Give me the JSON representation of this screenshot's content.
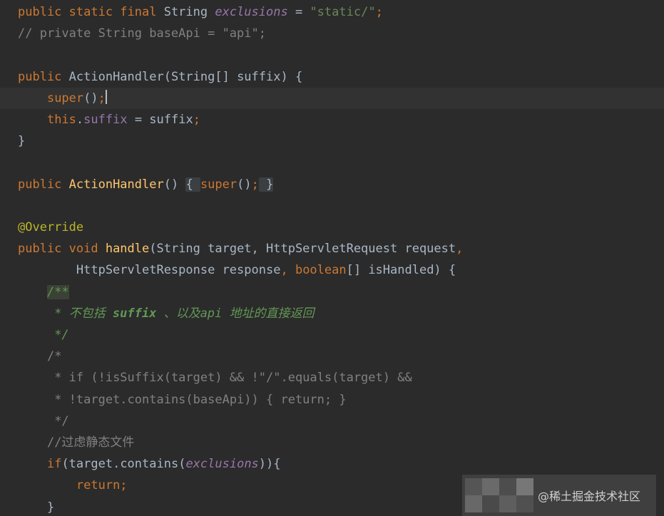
{
  "editor": {
    "lines": [
      [
        [
          "kw",
          "public static final "
        ],
        [
          "t",
          "String "
        ],
        [
          "fld",
          "exclusions"
        ],
        [
          "t",
          " = "
        ],
        [
          "str",
          "\"static/\""
        ],
        [
          "kw",
          ";"
        ]
      ],
      [
        [
          "cmt",
          "// private String baseApi = \"api\";"
        ]
      ],
      [],
      [
        [
          "kw",
          "public "
        ],
        [
          "ctor",
          "ActionHandler"
        ],
        [
          "t",
          "(String[] suffix) {"
        ]
      ],
      [
        [
          "t",
          "    "
        ],
        [
          "kw",
          "super"
        ],
        [
          "t",
          "()"
        ],
        [
          "kw",
          ";"
        ],
        [
          "caret",
          ""
        ]
      ],
      [
        [
          "t",
          "    "
        ],
        [
          "kw",
          "this"
        ],
        [
          "t",
          "."
        ],
        [
          "fldp",
          "suffix"
        ],
        [
          "t",
          " = suffix"
        ],
        [
          "kw",
          ";"
        ]
      ],
      [
        [
          "t",
          "}"
        ]
      ],
      [],
      [
        [
          "kw",
          "public "
        ],
        [
          "fn",
          "ActionHandler"
        ],
        [
          "t",
          "()"
        ],
        [
          "t",
          " "
        ],
        [
          "fold",
          "{ "
        ],
        [
          "kw",
          "super"
        ],
        [
          "t",
          "()"
        ],
        [
          "kw",
          ";"
        ],
        [
          "fold",
          " }"
        ]
      ],
      [],
      [
        [
          "ann",
          "@Override"
        ]
      ],
      [
        [
          "kw",
          "public void "
        ],
        [
          "fn",
          "handle"
        ],
        [
          "t",
          "(String target, HttpServletRequest request"
        ],
        [
          "kw",
          ","
        ]
      ],
      [
        [
          "t",
          "        HttpServletResponse response"
        ],
        [
          "kw",
          ", "
        ],
        [
          "kw",
          "boolean"
        ],
        [
          "t",
          "[] isHandled) {"
        ]
      ],
      [
        [
          "t",
          "    "
        ],
        [
          "hldoc",
          "/**"
        ]
      ],
      [
        [
          "t",
          "     "
        ],
        [
          "doc",
          "* 不包括 "
        ],
        [
          "docb",
          "suffix"
        ],
        [
          "doc",
          " 、以及api 地址的直接返回"
        ]
      ],
      [
        [
          "t",
          "     "
        ],
        [
          "doc",
          "*/"
        ]
      ],
      [
        [
          "t",
          "    "
        ],
        [
          "cmt",
          "/*"
        ]
      ],
      [
        [
          "t",
          "     "
        ],
        [
          "cmt",
          "* if (!isSuffix(target) && !\"/\".equals(target) &&"
        ]
      ],
      [
        [
          "t",
          "     "
        ],
        [
          "cmt",
          "* !target.contains(baseApi)) { return; }"
        ]
      ],
      [
        [
          "t",
          "     "
        ],
        [
          "cmt",
          "*/"
        ]
      ],
      [
        [
          "t",
          "    "
        ],
        [
          "cmt",
          "//过虑静态文件"
        ]
      ],
      [
        [
          "t",
          "    "
        ],
        [
          "kw",
          "if"
        ],
        [
          "t",
          "(target.contains("
        ],
        [
          "fld",
          "exclusions"
        ],
        [
          "t",
          ")){"
        ]
      ],
      [
        [
          "t",
          "        "
        ],
        [
          "kw",
          "return;"
        ]
      ],
      [
        [
          "t",
          "    }"
        ]
      ]
    ],
    "current_line": 4
  },
  "watermark": {
    "text": "@稀土掘金技术社区"
  }
}
